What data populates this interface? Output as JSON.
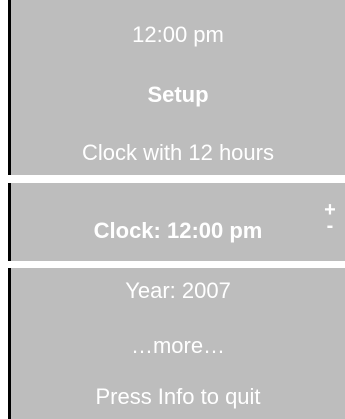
{
  "header": {
    "time": "12:00 pm",
    "title": "Setup",
    "mode": "Clock with 12 hours"
  },
  "selected_item": {
    "label": "Clock: 12:00 pm",
    "increase_symbol": "+",
    "decrease_symbol": "-"
  },
  "items": {
    "year": "Year: 2007",
    "more": "…more…",
    "quit_hint": "Press Info to quit"
  },
  "colors": {
    "panel": "#bdbdbd",
    "text": "#ffffff",
    "edge": "#000000"
  }
}
